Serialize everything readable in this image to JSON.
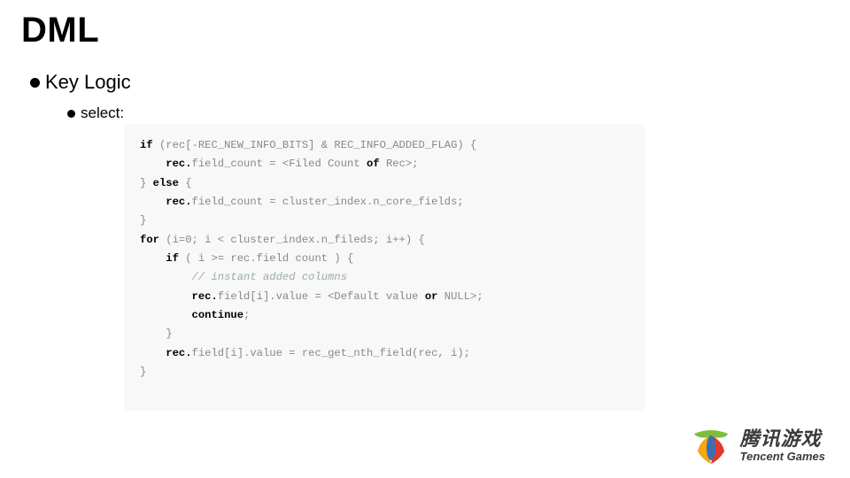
{
  "title": "DML",
  "bullet1": "Key Logic",
  "bullet2": "select:",
  "code": {
    "l1a": "if",
    "l1b": " (rec[-REC_NEW_INFO_BITS] & REC_INFO_ADDED_FLAG) {",
    "l2a": "    rec.",
    "l2b": "field_count = <Filed Count ",
    "l2c": "of",
    "l2d": " Rec>;",
    "l3a": "} ",
    "l3b": "else",
    "l3c": " {",
    "l4a": "    rec.",
    "l4b": "field_count = cluster_index.n_core_fields;",
    "l5": "}",
    "l6": "",
    "l7a": "for",
    "l7b": " (i=0; i < cluster_index.n_fileds; i++) {",
    "l8a": "    if",
    "l8b": " ( i >= rec.field count ) {",
    "l9": "        // instant added columns",
    "l10a": "        rec.",
    "l10b": "field[i].value = <Default value ",
    "l10c": "or",
    "l10d": " NULL>;",
    "l11a": "        continue",
    "l11b": ";",
    "l12": "    }",
    "l13": "",
    "l14a": "    rec.",
    "l14b": "field[i].value = rec_get_nth_field(rec, i);",
    "l15": "}"
  },
  "logo": {
    "cn": "腾讯游戏",
    "en": "Tencent Games"
  }
}
